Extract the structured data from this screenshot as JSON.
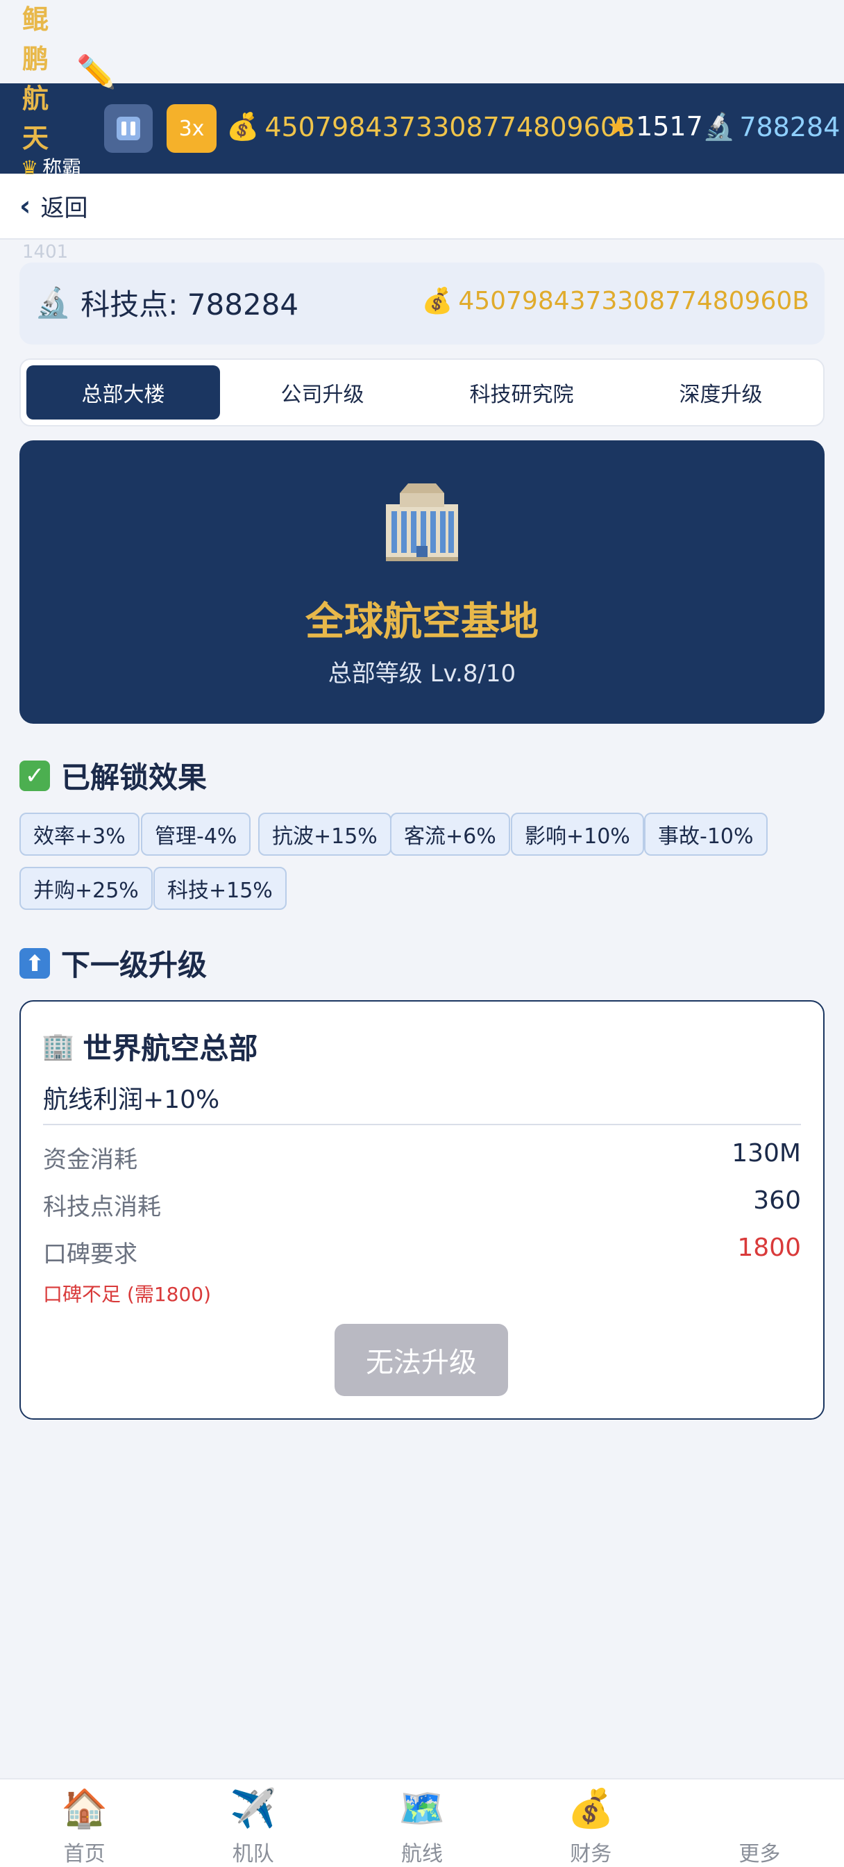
{
  "brand": {
    "chars": [
      "鲲",
      "鹏",
      "航",
      "天"
    ]
  },
  "rank": {
    "label": "称霸"
  },
  "header": {
    "speed_label": "3x",
    "money": "450798437330877480960B",
    "stars": "1517",
    "tech": "788284",
    "back_label": "返回",
    "faint_number": "1401"
  },
  "tech_card": {
    "label": "科技点: 788284",
    "money": "450798437330877480960B"
  },
  "tabs": [
    {
      "label": "总部大楼",
      "active": true
    },
    {
      "label": "公司升级",
      "active": false
    },
    {
      "label": "科技研究院",
      "active": false
    },
    {
      "label": "深度升级",
      "active": false
    }
  ],
  "hero": {
    "title": "全球航空基地",
    "subtitle": "总部等级 Lv.8/10"
  },
  "unlocked": {
    "title": "已解锁效果",
    "chips": [
      "效率+3%",
      "管理-4%",
      "抗波+15%",
      "客流+6%",
      "影响+10%",
      "事故-10%",
      "并购+25%",
      "科技+15%"
    ]
  },
  "next": {
    "section_title": "下一级升级",
    "title": "世界航空总部",
    "effect": "航线利润+10%",
    "rows": [
      {
        "label": "资金消耗",
        "value": "130M"
      },
      {
        "label": "科技点消耗",
        "value": "360"
      },
      {
        "label": "口碑要求",
        "value": "1800"
      }
    ],
    "warning": "口碑不足 (需1800)",
    "button_label": "无法升级"
  },
  "nav": [
    {
      "label": "首页",
      "icon": "house-icon"
    },
    {
      "label": "机队",
      "icon": "airplane-icon"
    },
    {
      "label": "航线",
      "icon": "map-icon"
    },
    {
      "label": "财务",
      "icon": "money-bag-icon"
    },
    {
      "label": "更多",
      "icon": "more-icon"
    }
  ],
  "colors": {
    "navy": "#1b3661",
    "gold": "#e8b84a",
    "warning_red": "#d93a3a",
    "disabled_gray": "#b9b9c2"
  }
}
